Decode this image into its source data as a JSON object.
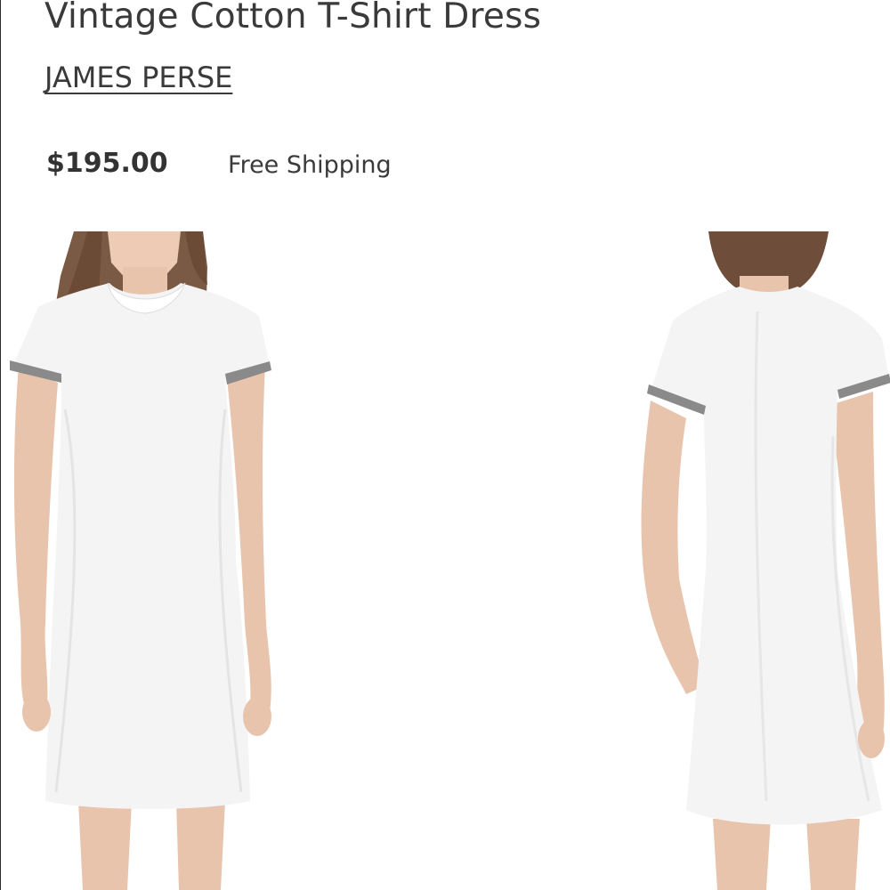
{
  "product": {
    "title": "Vintage Cotton T-Shirt Dress",
    "brand": "JAMES PERSE",
    "price": "$195.00",
    "shipping": "Free Shipping"
  },
  "images": [
    {
      "name": "product-photo-front",
      "view": "front"
    },
    {
      "name": "product-photo-back",
      "view": "back"
    }
  ],
  "colors": {
    "text": "#3a3a3a",
    "dress": "#f4f4f4",
    "trim": "#8a8a8a",
    "skin": "#e8c4ad",
    "hair": "#7a5a44"
  }
}
